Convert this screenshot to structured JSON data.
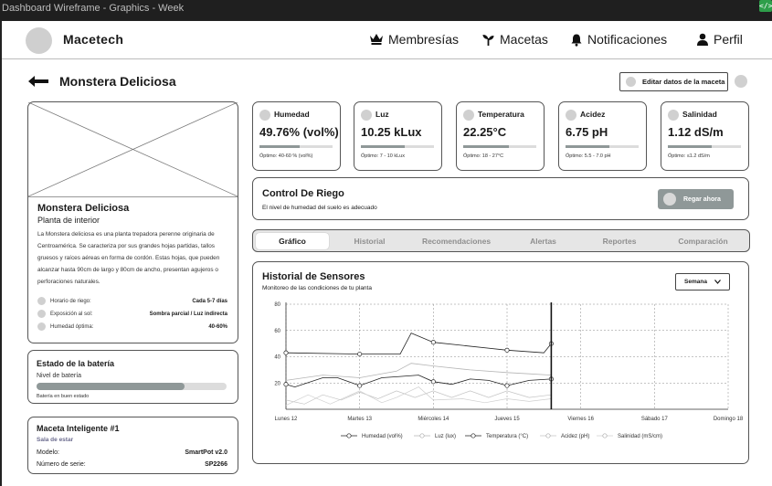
{
  "window": {
    "title": "Dashboard Wireframe - Graphics - Week"
  },
  "brand": {
    "name": "Macetech"
  },
  "nav": [
    {
      "label": "Membresías",
      "icon": "crown-icon"
    },
    {
      "label": "Macetas",
      "icon": "plant-icon"
    },
    {
      "label": "Notificaciones",
      "icon": "bell-icon"
    },
    {
      "label": "Perfil",
      "icon": "user-icon"
    }
  ],
  "page": {
    "title": "Monstera Deliciosa",
    "edit_label": "Editar datos de la maceta"
  },
  "plant": {
    "name": "Monstera Deliciosa",
    "type": "Planta de interior",
    "description": "La Monstera deliciosa es una planta trepadora perenne originaria de Centroamérica. Se caracteriza por sus grandes hojas partidas, tallos gruesos y raíces aéreas en forma de cordón. Estas hojas, que pueden alcanzar hasta 90cm de largo y 80cm de ancho, presentan agujeros o perforaciones naturales.",
    "details": [
      {
        "label": "Horario de riego:",
        "value": "Cada 5-7 días"
      },
      {
        "label": "Exposición al sol:",
        "value": "Sombra parcial / Luz indirecta"
      },
      {
        "label": "Humedad óptima:",
        "value": "40-60%"
      }
    ]
  },
  "battery": {
    "title": "Estado de la batería",
    "level_label": "Nivel de batería",
    "level": 0.78,
    "status": "Batería en buen estado"
  },
  "pot": {
    "title": "Maceta Inteligente #1",
    "location": "Sala de estar",
    "rows": [
      {
        "label": "Modelo:",
        "value": "SmartPot v2.0"
      },
      {
        "label": "Número de serie:",
        "value": "SP2266"
      }
    ]
  },
  "sensors": [
    {
      "name": "Humedad",
      "value": "49.76% (vol%)",
      "optimal": "Óptimo: 40-60 % (vol%)",
      "level": 0.55
    },
    {
      "name": "Luz",
      "value": "10.25 kLux",
      "optimal": "Óptimo: 7 - 10 kLux",
      "level": 0.6
    },
    {
      "name": "Temperatura",
      "value": "22.25°C",
      "optimal": "Óptimo: 18 - 27°C",
      "level": 0.62
    },
    {
      "name": "Acidez",
      "value": "6.75 pH",
      "optimal": "Óptimo: 5.5 - 7.0 pH",
      "level": 0.6
    },
    {
      "name": "Salinidad",
      "value": "1.12 dS/m",
      "optimal": "Óptimo: ≤1.2 dS/m",
      "level": 0.6
    }
  ],
  "irrigation": {
    "title": "Control De Riego",
    "message": "El nivel de humedad del suelo es adecuado",
    "button": "Regar ahora"
  },
  "tabs": [
    "Gráfico",
    "Historial",
    "Recomendaciones",
    "Alertas",
    "Reportes",
    "Comparación"
  ],
  "active_tab": 0,
  "history": {
    "title": "Historial de Sensores",
    "subtitle": "Monitoreo de las condiciones de tu planta",
    "range": "Semana"
  },
  "chart_data": {
    "type": "line",
    "x": [
      "Lunes 12",
      "Martes 13",
      "Miércoles 14",
      "Jueves 15",
      "Viernes 16",
      "Sábado 17",
      "Domingo 18"
    ],
    "ylim": [
      0,
      80
    ],
    "yticks": [
      20,
      40,
      60,
      80
    ],
    "grid": true,
    "legend_position": "bottom",
    "current_day_marker": 3.6,
    "series": [
      {
        "name": "Humedad (vol%)",
        "marker": true,
        "points": [
          [
            0,
            43
          ],
          [
            1,
            42
          ],
          [
            1.55,
            42
          ],
          [
            1.7,
            58
          ],
          [
            2,
            51
          ],
          [
            3,
            45
          ],
          [
            3.5,
            43
          ],
          [
            3.6,
            50
          ]
        ]
      },
      {
        "name": "Luz (lux)",
        "marker": false,
        "points": [
          [
            0,
            22
          ],
          [
            0.5,
            26
          ],
          [
            1,
            24
          ],
          [
            1.5,
            29
          ],
          [
            1.7,
            35
          ],
          [
            2,
            33
          ],
          [
            2.5,
            30
          ],
          [
            3,
            28
          ],
          [
            3.3,
            27
          ],
          [
            3.6,
            26
          ]
        ]
      },
      {
        "name": "Temperatura (°C)",
        "marker": true,
        "points": [
          [
            0,
            19
          ],
          [
            0.12,
            17
          ],
          [
            0.5,
            24
          ],
          [
            0.7,
            24
          ],
          [
            1,
            18
          ],
          [
            1.3,
            24
          ],
          [
            1.55,
            25
          ],
          [
            1.8,
            26
          ],
          [
            2,
            21
          ],
          [
            2.25,
            19
          ],
          [
            2.5,
            23
          ],
          [
            2.75,
            22
          ],
          [
            3,
            18
          ],
          [
            3.3,
            22
          ],
          [
            3.6,
            23
          ]
        ]
      },
      {
        "name": "Acidez (pH)",
        "marker": false,
        "points": [
          [
            0,
            7
          ],
          [
            0.25,
            4
          ],
          [
            0.5,
            11
          ],
          [
            0.75,
            7
          ],
          [
            1,
            13
          ],
          [
            1.25,
            8
          ],
          [
            1.5,
            14
          ],
          [
            1.75,
            9
          ],
          [
            2,
            14
          ],
          [
            2.25,
            9
          ],
          [
            2.5,
            14
          ],
          [
            2.75,
            9
          ],
          [
            3,
            14
          ],
          [
            3.3,
            9
          ],
          [
            3.6,
            11
          ]
        ]
      },
      {
        "name": "Salinidad (mS/cm)",
        "marker": false,
        "points": [
          [
            0,
            3
          ],
          [
            0.3,
            11
          ],
          [
            0.6,
            4
          ],
          [
            1,
            14
          ],
          [
            1.3,
            5
          ],
          [
            1.5,
            9
          ],
          [
            1.8,
            17
          ],
          [
            2,
            7
          ],
          [
            2.4,
            8
          ],
          [
            2.7,
            5
          ],
          [
            3,
            8
          ],
          [
            3.3,
            6
          ],
          [
            3.6,
            8
          ]
        ]
      }
    ]
  }
}
